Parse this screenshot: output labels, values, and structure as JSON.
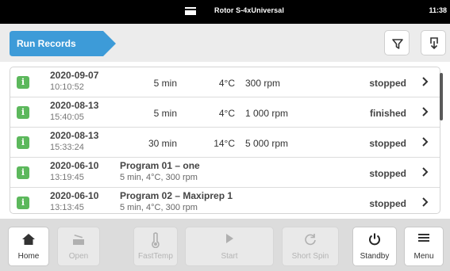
{
  "status_bar": {
    "device_name": "Rotor S-4xUniversal",
    "time": "11:38"
  },
  "header": {
    "tab_label": "Run Records",
    "accent_color": "#3d9bd8"
  },
  "records": [
    {
      "date": "2020-09-07",
      "time": "10:10:52",
      "duration": "5 min",
      "temperature": "4°C",
      "speed": "300 rpm",
      "status": "stopped"
    },
    {
      "date": "2020-08-13",
      "time": "15:40:05",
      "duration": "5 min",
      "temperature": "4°C",
      "speed": "1 000 rpm",
      "status": "finished"
    },
    {
      "date": "2020-08-13",
      "time": "15:33:24",
      "duration": "30 min",
      "temperature": "14°C",
      "speed": "5 000 rpm",
      "status": "stopped"
    },
    {
      "date": "2020-06-10",
      "time": "13:19:45",
      "program": "Program 01 – one",
      "program_details": "5 min, 4°C, 300 rpm",
      "status": "stopped"
    },
    {
      "date": "2020-06-10",
      "time": "13:13:45",
      "program": "Program 02 – Maxiprep 1",
      "program_details": "5 min, 4°C, 300 rpm",
      "status": "stopped"
    }
  ],
  "toolbar": {
    "home": "Home",
    "open": "Open",
    "fasttemp": "FastTemp",
    "start": "Start",
    "short_spin": "Short Spin",
    "standby": "Standby",
    "menu": "Menu"
  }
}
